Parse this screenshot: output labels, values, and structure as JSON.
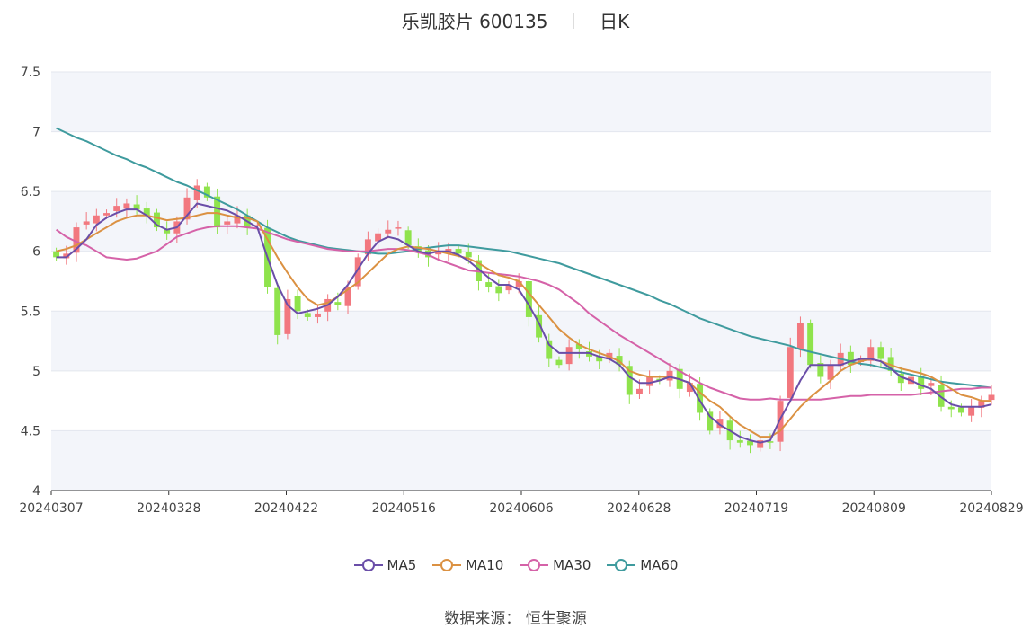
{
  "header": {
    "name": "乐凯胶片 600135",
    "period": "日K"
  },
  "source": "数据来源： 恒生聚源",
  "colors": {
    "up": "#f2787f",
    "down": "#8fe34c",
    "MA5": "#6a4ea8",
    "MA10": "#db9142",
    "MA30": "#d562a8",
    "MA60": "#3f9b9e",
    "band": "#f3f5fa",
    "grid": "#e3e6ee",
    "axis": "#333333"
  },
  "chart_data": {
    "type": "candlestick",
    "ylim": [
      4,
      7.5
    ],
    "y_ticks": [
      "4",
      "4.5",
      "5",
      "5.5",
      "6",
      "6.5",
      "7",
      "7.5"
    ],
    "x_ticks": [
      "20240307",
      "20240328",
      "20240422",
      "20240516",
      "20240606",
      "20240628",
      "20240719",
      "20240809",
      "20240829"
    ],
    "legend": [
      "MA5",
      "MA10",
      "MA30",
      "MA60"
    ],
    "closes": [
      5.95,
      5.98,
      6.2,
      6.25,
      6.3,
      6.32,
      6.38,
      6.4,
      6.35,
      6.3,
      6.2,
      6.15,
      6.25,
      6.45,
      6.55,
      6.45,
      6.2,
      6.25,
      6.3,
      6.2,
      6.22,
      5.7,
      5.3,
      5.6,
      5.5,
      5.45,
      5.48,
      5.6,
      5.55,
      5.7,
      5.95,
      6.1,
      6.15,
      6.18,
      6.2,
      6.05,
      6.0,
      5.95,
      6.0,
      6.02,
      5.98,
      5.95,
      5.75,
      5.7,
      5.65,
      5.72,
      5.75,
      5.45,
      5.28,
      5.1,
      5.05,
      5.2,
      5.18,
      5.12,
      5.08,
      5.15,
      5.05,
      4.8,
      4.85,
      4.95,
      4.92,
      5.0,
      4.85,
      4.9,
      4.65,
      4.5,
      4.6,
      4.42,
      4.4,
      4.38,
      4.42,
      4.4,
      4.75,
      5.2,
      5.4,
      5.05,
      4.95,
      5.05,
      5.15,
      5.05,
      5.1,
      5.2,
      5.1,
      5.0,
      4.9,
      4.95,
      4.85,
      4.9,
      4.7,
      4.68,
      4.65,
      4.7,
      4.75,
      4.8
    ],
    "MA5": [
      5.95,
      5.95,
      6.02,
      6.1,
      6.22,
      6.28,
      6.32,
      6.35,
      6.35,
      6.3,
      6.22,
      6.18,
      6.2,
      6.3,
      6.4,
      6.38,
      6.36,
      6.34,
      6.3,
      6.25,
      6.2,
      5.95,
      5.72,
      5.55,
      5.48,
      5.5,
      5.52,
      5.55,
      5.62,
      5.72,
      5.85,
      5.98,
      6.08,
      6.12,
      6.1,
      6.05,
      6.0,
      5.98,
      6.0,
      6.0,
      5.97,
      5.92,
      5.85,
      5.78,
      5.72,
      5.72,
      5.68,
      5.55,
      5.4,
      5.22,
      5.15,
      5.15,
      5.15,
      5.15,
      5.12,
      5.1,
      5.05,
      4.95,
      4.9,
      4.9,
      4.92,
      4.95,
      4.93,
      4.9,
      4.75,
      4.62,
      4.55,
      4.5,
      4.45,
      4.42,
      4.4,
      4.42,
      4.6,
      4.75,
      4.92,
      5.05,
      5.05,
      5.05,
      5.05,
      5.08,
      5.1,
      5.1,
      5.08,
      5.02,
      4.95,
      4.92,
      4.88,
      4.85,
      4.78,
      4.72,
      4.7,
      4.7,
      4.7,
      4.72
    ],
    "MA10": [
      6.0,
      6.02,
      6.05,
      6.1,
      6.15,
      6.2,
      6.25,
      6.28,
      6.3,
      6.3,
      6.28,
      6.26,
      6.27,
      6.28,
      6.3,
      6.32,
      6.32,
      6.3,
      6.28,
      6.28,
      6.25,
      6.1,
      5.95,
      5.82,
      5.7,
      5.6,
      5.55,
      5.57,
      5.62,
      5.68,
      5.74,
      5.82,
      5.9,
      5.98,
      6.02,
      6.04,
      6.03,
      6.02,
      6.0,
      5.98,
      5.96,
      5.94,
      5.9,
      5.85,
      5.8,
      5.78,
      5.75,
      5.65,
      5.55,
      5.45,
      5.35,
      5.28,
      5.22,
      5.18,
      5.15,
      5.12,
      5.08,
      5.0,
      4.97,
      4.95,
      4.95,
      4.95,
      4.93,
      4.9,
      4.82,
      4.75,
      4.7,
      4.62,
      4.55,
      4.5,
      4.45,
      4.45,
      4.5,
      4.6,
      4.7,
      4.78,
      4.85,
      4.92,
      5.0,
      5.05,
      5.08,
      5.1,
      5.08,
      5.05,
      5.02,
      5.0,
      4.98,
      4.95,
      4.9,
      4.85,
      4.8,
      4.78,
      4.75,
      4.75
    ],
    "MA30": [
      6.18,
      6.12,
      6.08,
      6.05,
      6.0,
      5.95,
      5.94,
      5.93,
      5.94,
      5.97,
      6.0,
      6.06,
      6.12,
      6.15,
      6.18,
      6.2,
      6.21,
      6.21,
      6.21,
      6.2,
      6.19,
      6.16,
      6.13,
      6.1,
      6.08,
      6.06,
      6.04,
      6.02,
      6.01,
      6.0,
      6.0,
      6.0,
      6.01,
      6.02,
      6.02,
      6.01,
      5.99,
      5.97,
      5.93,
      5.9,
      5.87,
      5.84,
      5.83,
      5.82,
      5.81,
      5.8,
      5.79,
      5.77,
      5.75,
      5.72,
      5.68,
      5.62,
      5.56,
      5.48,
      5.42,
      5.36,
      5.3,
      5.25,
      5.2,
      5.15,
      5.1,
      5.05,
      5.0,
      4.95,
      4.9,
      4.86,
      4.83,
      4.8,
      4.77,
      4.76,
      4.76,
      4.77,
      4.76,
      4.76,
      4.76,
      4.76,
      4.76,
      4.77,
      4.78,
      4.79,
      4.79,
      4.8,
      4.8,
      4.8,
      4.8,
      4.8,
      4.81,
      4.82,
      4.83,
      4.84,
      4.85,
      4.85,
      4.86,
      4.86
    ],
    "MA60": [
      7.03,
      6.99,
      6.95,
      6.92,
      6.88,
      6.84,
      6.8,
      6.77,
      6.73,
      6.7,
      6.66,
      6.62,
      6.58,
      6.55,
      6.51,
      6.47,
      6.43,
      6.39,
      6.35,
      6.3,
      6.25,
      6.2,
      6.16,
      6.12,
      6.09,
      6.07,
      6.05,
      6.03,
      6.02,
      6.01,
      6.0,
      5.99,
      5.98,
      5.98,
      5.99,
      6.0,
      6.02,
      6.03,
      6.04,
      6.05,
      6.05,
      6.04,
      6.03,
      6.02,
      6.01,
      6.0,
      5.98,
      5.96,
      5.94,
      5.92,
      5.9,
      5.87,
      5.84,
      5.81,
      5.78,
      5.75,
      5.72,
      5.69,
      5.66,
      5.63,
      5.59,
      5.56,
      5.52,
      5.48,
      5.44,
      5.41,
      5.38,
      5.35,
      5.32,
      5.29,
      5.27,
      5.25,
      5.23,
      5.21,
      5.18,
      5.16,
      5.14,
      5.12,
      5.1,
      5.08,
      5.06,
      5.05,
      5.03,
      5.01,
      4.99,
      4.97,
      4.95,
      4.93,
      4.91,
      4.9,
      4.89,
      4.88,
      4.87,
      4.86
    ]
  }
}
